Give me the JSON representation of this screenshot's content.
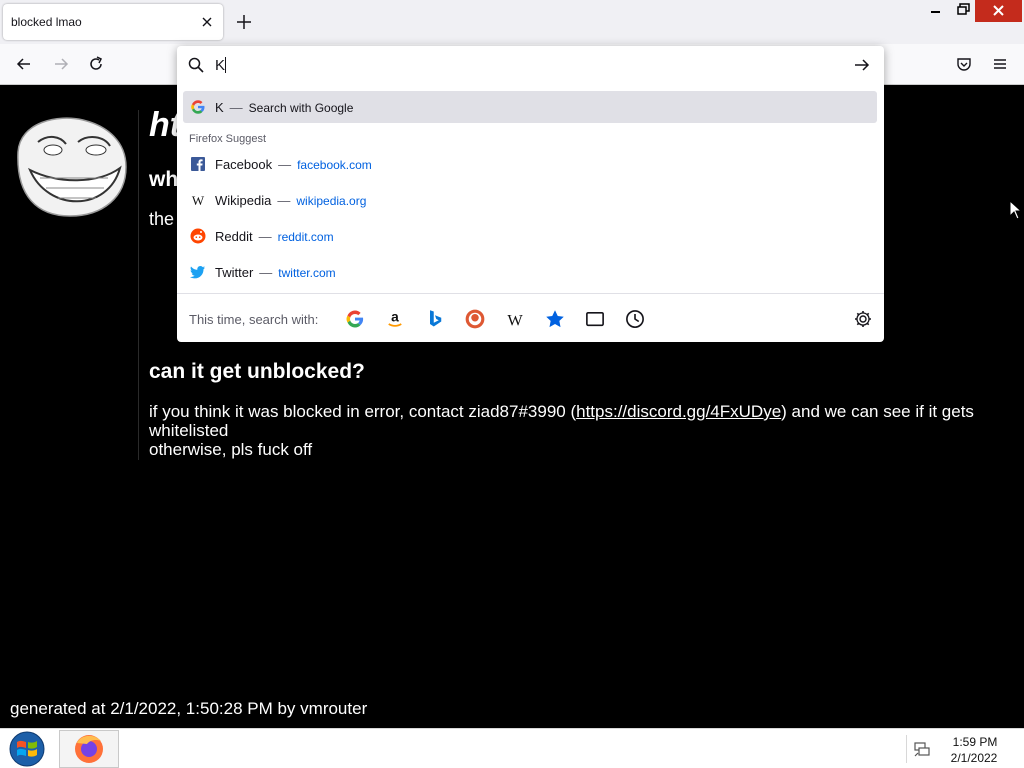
{
  "tab": {
    "title": "blocked lmao"
  },
  "urlbar": {
    "value": "K",
    "heuristic": {
      "query": "K",
      "action": "Search with Google"
    },
    "group_label": "Firefox Suggest",
    "suggestions": [
      {
        "title": "Facebook",
        "url": "facebook.com",
        "icon": "facebook-icon"
      },
      {
        "title": "Wikipedia",
        "url": "wikipedia.org",
        "icon": "wikipedia-icon"
      },
      {
        "title": "Reddit",
        "url": "reddit.com",
        "icon": "reddit-icon"
      },
      {
        "title": "Twitter",
        "url": "twitter.com",
        "icon": "twitter-icon"
      }
    ],
    "oneoff_label": "This time, search with:",
    "engines": [
      "google-icon",
      "amazon-icon",
      "bing-icon",
      "duckduckgo-icon",
      "wikipedia-icon",
      "bookmarks-icon",
      "tabs-icon",
      "history-icon"
    ]
  },
  "page": {
    "h1_fragment": "ht",
    "h2_fragment": "wh",
    "p_fragment": "the",
    "unblock_heading": "can it get unblocked?",
    "unblock_text_before": "if you think it was blocked in error, contact ziad87#3990 (",
    "unblock_link": "https://discord.gg/4FxUDye",
    "unblock_text_after": ") and we can see if it gets whitelisted",
    "unblock_line2": "otherwise, pls fuck off",
    "footer": "generated at 2/1/2022, 1:50:28 PM by vmrouter"
  },
  "taskbar": {
    "time": "1:59 PM",
    "date": "2/1/2022"
  },
  "colors": {
    "accent": "#0061e0",
    "close": "#c42b1c",
    "page_bg": "#000000"
  }
}
